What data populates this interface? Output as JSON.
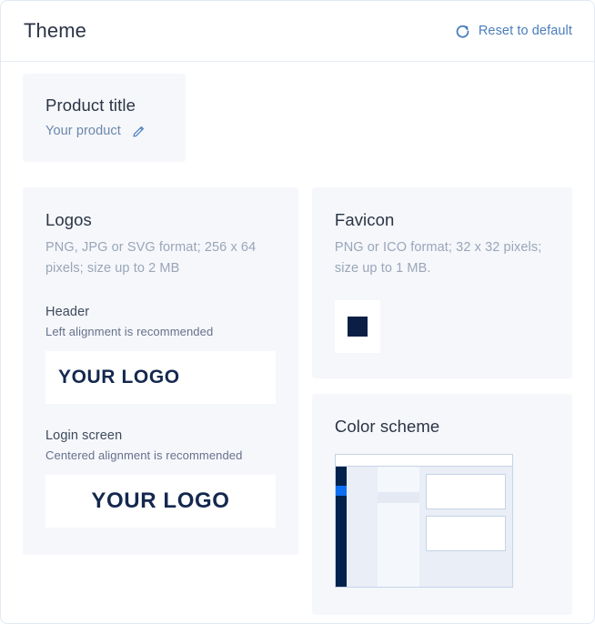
{
  "header": {
    "title": "Theme",
    "reset_label": "Reset to default",
    "reset_icon": "refresh-circle-icon"
  },
  "product_title_card": {
    "title": "Product title",
    "value": "Your product",
    "edit_icon": "pencil-icon"
  },
  "logos_card": {
    "heading": "Logos",
    "description": "PNG, JPG or SVG format; 256 x 64 pixels; size up to 2 MB",
    "header_section": {
      "label": "Header",
      "hint": "Left alignment is recommended",
      "logo_text": "YOUR LOGO",
      "alignment": "left"
    },
    "login_section": {
      "label": "Login screen",
      "hint": "Centered alignment is recommended",
      "logo_text": "YOUR LOGO",
      "alignment": "center"
    }
  },
  "favicon_card": {
    "heading": "Favicon",
    "description": "PNG or ICO format; 32 x 32 pixels; size up to 1 MB.",
    "favicon_color": "#0b1f45"
  },
  "color_scheme_card": {
    "heading": "Color scheme",
    "preview_colors": {
      "sidebar": "#03214d",
      "sidebar_active": "#0f6ff2",
      "topbar": "#ffffff",
      "rail": "#e9eef7",
      "list": "#f4f7fc",
      "list_row": "#e3eaf4",
      "content": "#e9eef7",
      "panel": "#ffffff",
      "border": "#c6d4e6"
    }
  },
  "theme": {
    "page_background": "#ffffff",
    "card_background": "#f5f7fb",
    "accent": "#4a7ebb",
    "title_color": "#2b3445",
    "muted_text": "#9aa6b8",
    "logo_color": "#14284f"
  }
}
